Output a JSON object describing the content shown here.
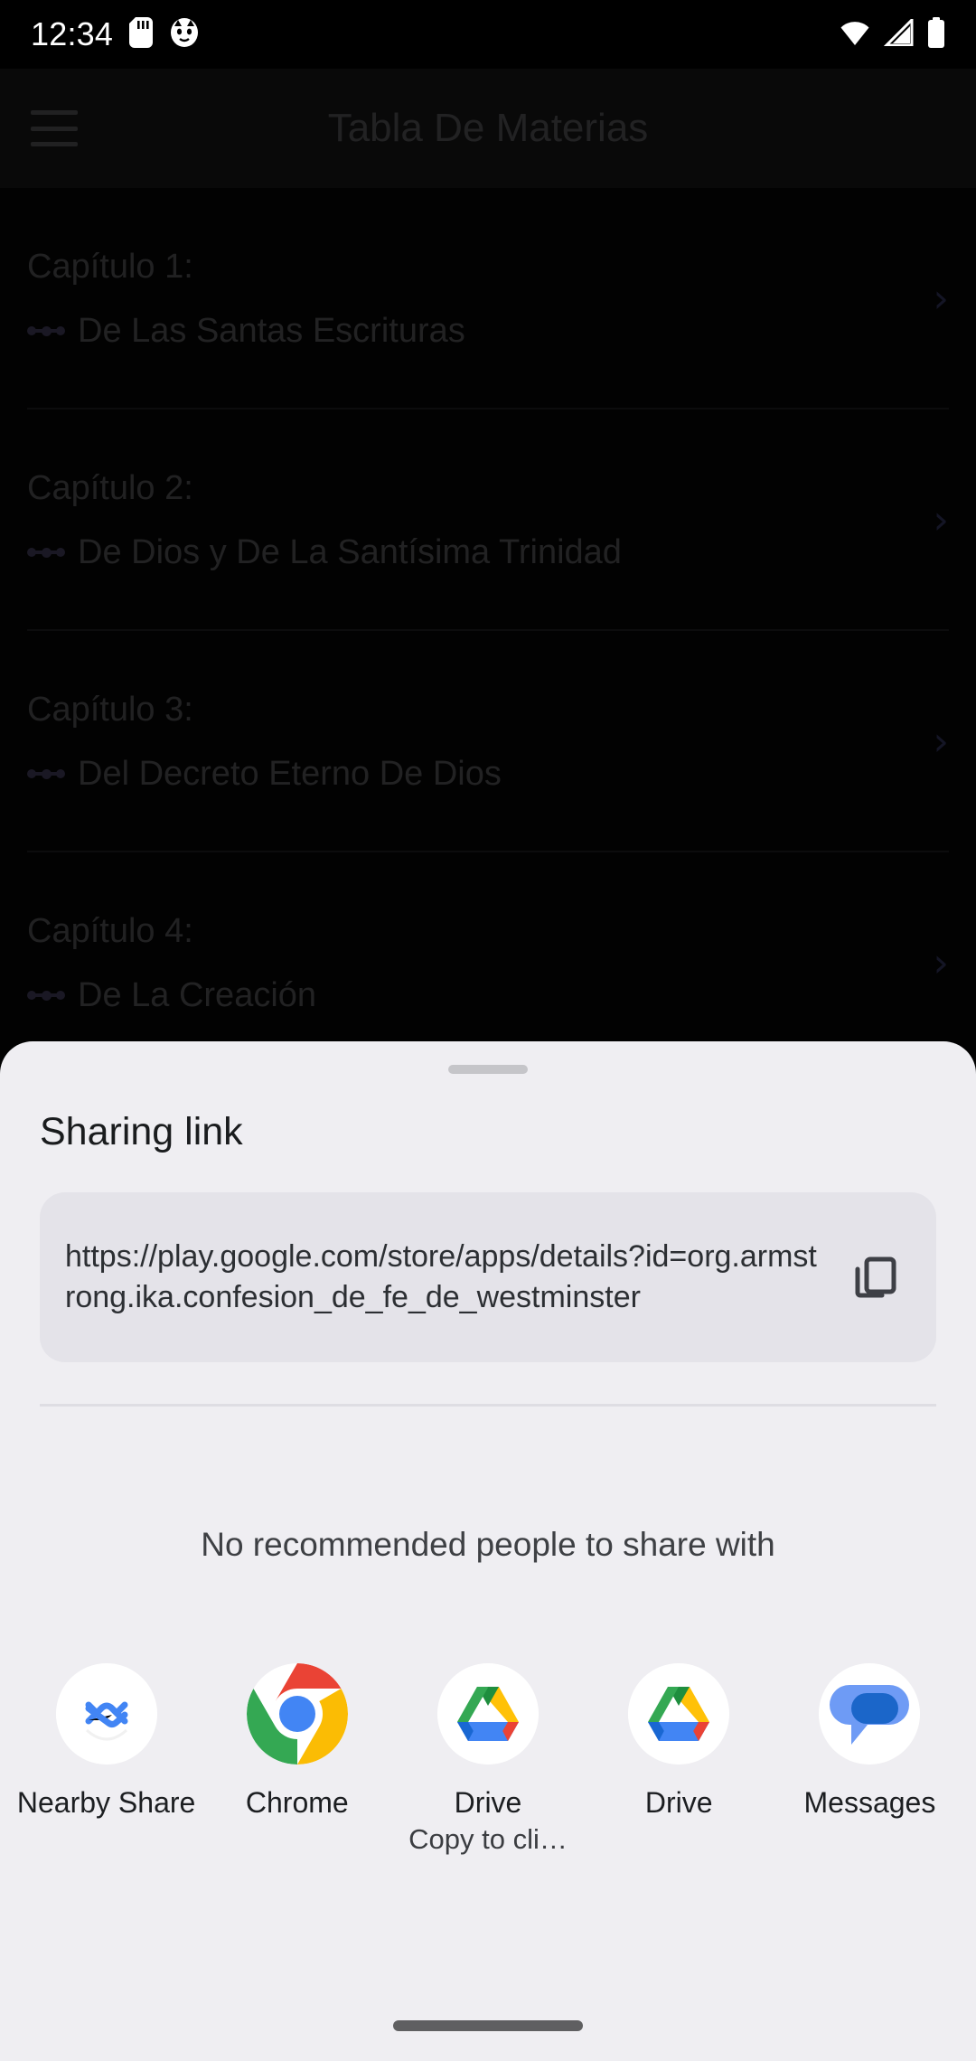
{
  "status_bar": {
    "time": "12:34",
    "left_icons": [
      "sd-card-icon",
      "cat-app-icon"
    ],
    "right_icons": [
      "wifi-icon",
      "cellular-signal-icon",
      "battery-icon"
    ]
  },
  "background_app": {
    "menu_icon": "hamburger-menu-icon",
    "title": "Tabla De Materias",
    "chapters": [
      {
        "number": "Capítulo 1:",
        "subtitle": "De Las Santas Escrituras",
        "chevron": "›"
      },
      {
        "number": "Capítulo 2:",
        "subtitle": "De Dios y De La Santísima Trinidad",
        "chevron": "›"
      },
      {
        "number": "Capítulo 3:",
        "subtitle": "Del Decreto Eterno De Dios",
        "chevron": "›"
      },
      {
        "number": "Capítulo 4:",
        "subtitle": "De La Creación",
        "chevron": "›"
      }
    ]
  },
  "share_sheet": {
    "handle": "drag-handle",
    "title": "Sharing link",
    "link": {
      "url": "https://play.google.com/store/apps/details?id=org.armstrong.ika.confesion_de_fe_de_westminster",
      "copy_icon": "copy-icon"
    },
    "empty_recommendations_text": "No recommended people to share with",
    "apps": [
      {
        "name": "Nearby Share",
        "icon": "nearby-share-icon",
        "subtitle": ""
      },
      {
        "name": "Chrome",
        "icon": "chrome-icon",
        "subtitle": ""
      },
      {
        "name": "Drive",
        "icon": "google-drive-icon",
        "subtitle": "Copy to cli…"
      },
      {
        "name": "Drive",
        "icon": "google-drive-icon",
        "subtitle": ""
      },
      {
        "name": "Messages",
        "icon": "google-messages-icon",
        "subtitle": ""
      }
    ]
  },
  "navigation_bar": {
    "pill": "home-gesture-pill"
  },
  "colors": {
    "sheet_background": "#EFEEF2",
    "link_card_background": "#E4E3E9",
    "accent_blue": "#4285F4",
    "chrome_red": "#EA4335",
    "chrome_yellow": "#FBBC04",
    "chrome_green": "#34A853",
    "drive_blue": "#2684FC",
    "messages_blue": "#1B66C9"
  }
}
